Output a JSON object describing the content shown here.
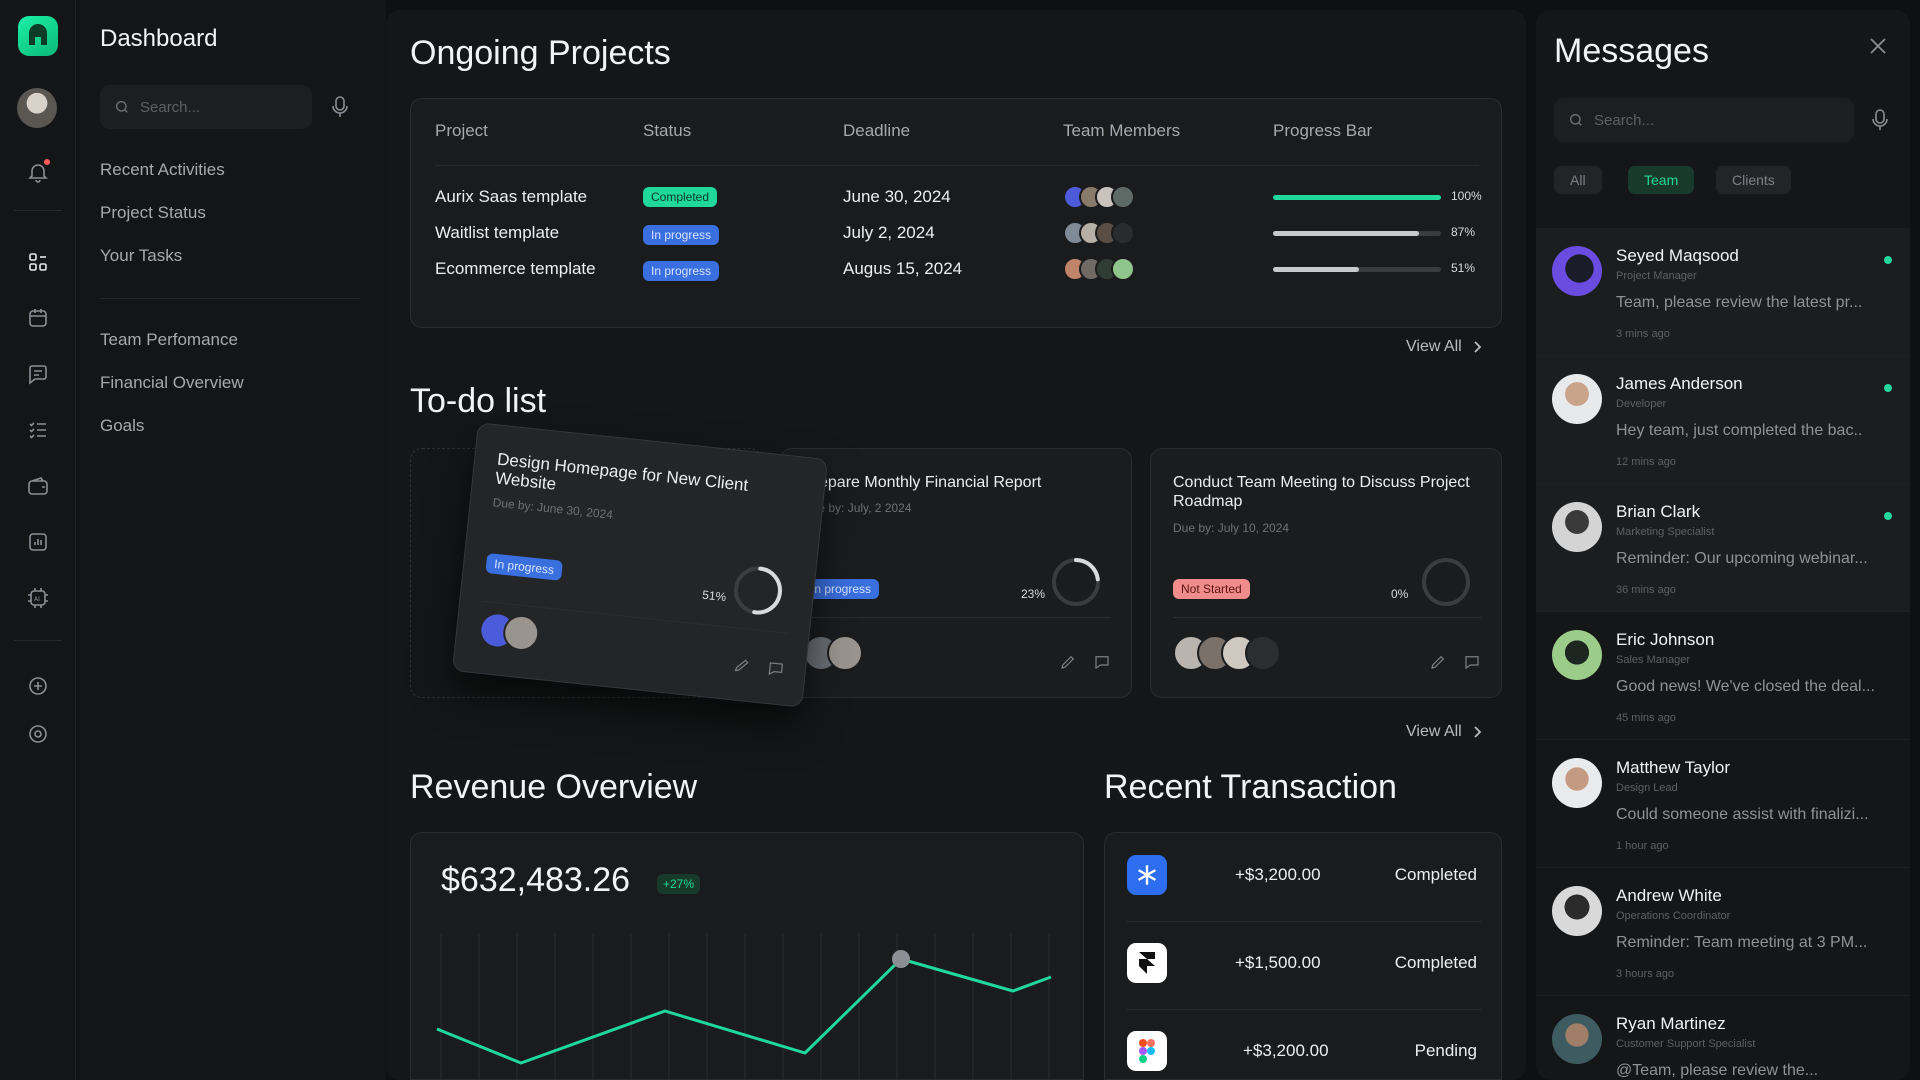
{
  "sidebar": {
    "title": "Dashboard",
    "search_placeholder": "Search...",
    "group1": [
      "Recent Activities",
      "Project Status",
      "Your Tasks"
    ],
    "group2": [
      "Team Perfomance",
      "Financial Overview",
      "Goals"
    ]
  },
  "rail_icons": [
    "logo-icon",
    "avatar",
    "bell-icon",
    "grid-icon",
    "calendar-icon",
    "chat-icon",
    "checklist-icon",
    "wallet-icon",
    "chart-icon",
    "ai-chip-icon",
    "plus-circle-icon",
    "settings-icon"
  ],
  "projects": {
    "title": "Ongoing Projects",
    "headers": [
      "Project",
      "Status",
      "Deadline",
      "Team Members",
      "Progress Bar"
    ],
    "rows": [
      {
        "name": "Aurix Saas template",
        "status": "Completed",
        "deadline": "June 30, 2024",
        "progress": 100,
        "progress_label": "100%"
      },
      {
        "name": "Waitlist template",
        "status": "In progress",
        "deadline": "July 2, 2024",
        "progress": 87,
        "progress_label": "87%"
      },
      {
        "name": "Ecommerce template",
        "status": "In progress",
        "deadline": "Augus 15, 2024",
        "progress": 51,
        "progress_label": "51%"
      }
    ],
    "view_all": "View All"
  },
  "todo": {
    "title": "To-do list",
    "cards": [
      {
        "title": "Design Homepage for New Client Website",
        "due": "Due by: June 30, 2024",
        "status": "In progress",
        "pct": 51,
        "pct_label": "51%"
      },
      {
        "title": "Prepare Monthly Financial Report",
        "due": "Due by: July, 2 2024",
        "status": "In progress",
        "pct": 23,
        "pct_label": "23%"
      },
      {
        "title": "Conduct Team Meeting to Discuss Project Roadmap",
        "due": "Due by: July 10, 2024",
        "status": "Not Started",
        "pct": 0,
        "pct_label": "0%"
      }
    ],
    "view_all": "View All"
  },
  "revenue": {
    "title": "Revenue Overview",
    "amount": "$632,483.26",
    "change": "+27%"
  },
  "transactions": {
    "title": "Recent  Transaction",
    "rows": [
      {
        "icon": "snowflake-app-icon",
        "amount": "+$3,200.00",
        "status": "Completed"
      },
      {
        "icon": "framer-app-icon",
        "amount": "+$1,500.00",
        "status": "Completed"
      },
      {
        "icon": "figma-app-icon",
        "amount": "+$3,200.00",
        "status": "Pending"
      }
    ]
  },
  "messages": {
    "title": "Messages",
    "search_placeholder": "Search...",
    "filters": [
      "All",
      "Team",
      "Clients"
    ],
    "active_filter": "Team",
    "items": [
      {
        "name": "Seyed Maqsood",
        "role": "Project Manager",
        "text": "Team, please review the latest pr...",
        "time": "3 mins ago",
        "unread": true
      },
      {
        "name": "James Anderson",
        "role": "Developer",
        "text": "Hey team, just completed the bac..",
        "time": "12 mins ago",
        "unread": true
      },
      {
        "name": "Brian Clark",
        "role": "Marketing Specialist",
        "text": "Reminder: Our upcoming webinar...",
        "time": "36 mins ago",
        "unread": true
      },
      {
        "name": "Eric Johnson",
        "role": "Sales Manager",
        "text": "Good news! We've closed the deal...",
        "time": "45 mins ago",
        "unread": false
      },
      {
        "name": "Matthew Taylor",
        "role": "Design Lead",
        "text": "Could someone assist with finalizi...",
        "time": "1 hour ago",
        "unread": false
      },
      {
        "name": "Andrew White",
        "role": "Operations Coordinator",
        "text": "Reminder: Team meeting at 3 PM...",
        "time": "3 hours ago",
        "unread": false
      },
      {
        "name": "Ryan Martinez",
        "role": "Customer Support Specialist",
        "text": "@Team, please review the...",
        "time": "",
        "unread": false
      }
    ]
  },
  "colors": {
    "accent": "#1fd89a",
    "in_progress": "#3a6fe0",
    "not_started": "#f08c8c"
  }
}
